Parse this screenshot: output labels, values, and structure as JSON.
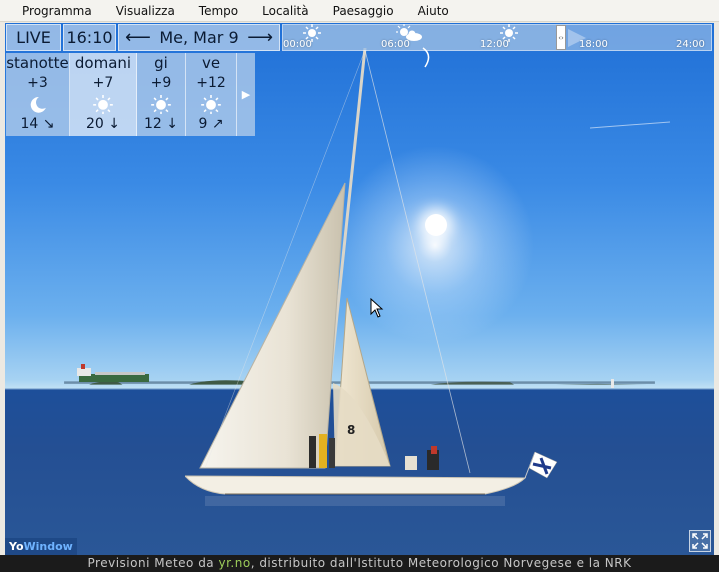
{
  "menu": [
    "Programma",
    "Visualizza",
    "Tempo",
    "Località",
    "Paesaggio",
    "Aiuto"
  ],
  "timebar": {
    "live_label": "LIVE",
    "time": "16:10",
    "date": "Me, Mar 9",
    "prev_arrow": "⟵",
    "next_arrow": "⟶",
    "ticks": [
      "00:00",
      "06:00",
      "12:00",
      "18:00",
      "24:00"
    ],
    "handle_glyph": "‹›"
  },
  "forecast": [
    {
      "day": "stanotte",
      "temp": "+3",
      "icon": "moon-icon",
      "wind_speed": "14",
      "wind_arrow": "↘"
    },
    {
      "day": "domani",
      "temp": "+7",
      "icon": "sun-icon",
      "wind_speed": "20",
      "wind_arrow": "↓"
    },
    {
      "day": "gi",
      "temp": "+9",
      "icon": "sun-icon",
      "wind_speed": "12",
      "wind_arrow": "↓"
    },
    {
      "day": "ve",
      "temp": "+12",
      "icon": "sun-icon",
      "wind_speed": "9",
      "wind_arrow": "↗"
    }
  ],
  "forecast_next": "▶",
  "logo": {
    "part1": "Yo",
    "part2": "Window"
  },
  "status": {
    "prefix": "Previsioni Meteo da ",
    "link": "yr.no",
    "suffix": ", distribuito dall'Istituto Meteorologico Norvegese e la NRK"
  },
  "colors": {
    "sky": "#3a8ae5",
    "sea": "#244f93",
    "status_link": "#9ccc5a"
  }
}
